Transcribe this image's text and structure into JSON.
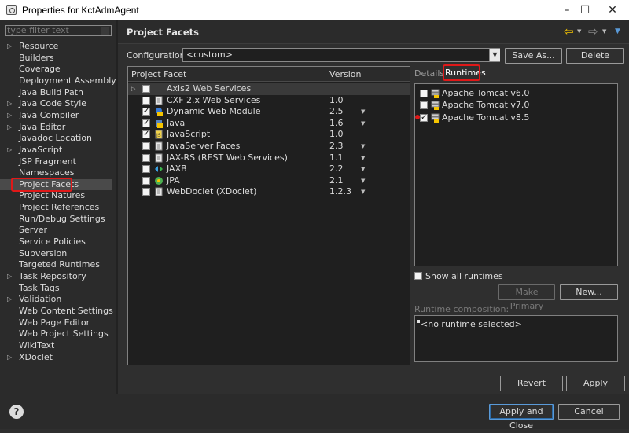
{
  "window": {
    "title": "Properties for KctAdmAgent",
    "minimize": "–",
    "maximize": "☐",
    "close": "✕"
  },
  "sidebar": {
    "filter_placeholder": "type filter text",
    "items": [
      {
        "label": "Resource",
        "expandable": true
      },
      {
        "label": "Builders",
        "expandable": false
      },
      {
        "label": "Coverage",
        "expandable": false
      },
      {
        "label": "Deployment Assembly",
        "expandable": false
      },
      {
        "label": "Java Build Path",
        "expandable": false
      },
      {
        "label": "Java Code Style",
        "expandable": true
      },
      {
        "label": "Java Compiler",
        "expandable": true
      },
      {
        "label": "Java Editor",
        "expandable": true
      },
      {
        "label": "Javadoc Location",
        "expandable": false
      },
      {
        "label": "JavaScript",
        "expandable": true
      },
      {
        "label": "JSP Fragment",
        "expandable": false
      },
      {
        "label": "Namespaces",
        "expandable": false
      },
      {
        "label": "Project Facets",
        "expandable": false,
        "selected": true
      },
      {
        "label": "Project Natures",
        "expandable": false
      },
      {
        "label": "Project References",
        "expandable": false
      },
      {
        "label": "Run/Debug Settings",
        "expandable": false
      },
      {
        "label": "Server",
        "expandable": false
      },
      {
        "label": "Service Policies",
        "expandable": false
      },
      {
        "label": "Subversion",
        "expandable": false
      },
      {
        "label": "Targeted Runtimes",
        "expandable": false
      },
      {
        "label": "Task Repository",
        "expandable": true
      },
      {
        "label": "Task Tags",
        "expandable": false
      },
      {
        "label": "Validation",
        "expandable": true
      },
      {
        "label": "Web Content Settings",
        "expandable": false
      },
      {
        "label": "Web Page Editor",
        "expandable": false
      },
      {
        "label": "Web Project Settings",
        "expandable": false
      },
      {
        "label": "WikiText",
        "expandable": false
      },
      {
        "label": "XDoclet",
        "expandable": true
      }
    ]
  },
  "header": {
    "title": "Project Facets",
    "back_icon": "arrow-left-icon",
    "forward_icon": "arrow-right-icon",
    "menu_icon": "chevron-down-icon",
    "accent_color": "#f5c400"
  },
  "configuration": {
    "label": "Configuration:",
    "value": "<custom>",
    "save_as": "Save As...",
    "delete": "Delete"
  },
  "facets": {
    "col_facet": "Project Facet",
    "col_version": "Version",
    "rows": [
      {
        "name": "Axis2 Web Services",
        "version": "",
        "checked": false,
        "expandable": true,
        "has_dropdown": false,
        "icon": "none",
        "highlight": true
      },
      {
        "name": "CXF 2.x Web Services",
        "version": "1.0",
        "checked": false,
        "expandable": false,
        "has_dropdown": false,
        "icon": "document-icon"
      },
      {
        "name": "Dynamic Web Module",
        "version": "2.5",
        "checked": true,
        "expandable": false,
        "has_dropdown": true,
        "icon": "web-module-icon"
      },
      {
        "name": "Java",
        "version": "1.6",
        "checked": true,
        "expandable": false,
        "has_dropdown": true,
        "icon": "java-icon"
      },
      {
        "name": "JavaScript",
        "version": "1.0",
        "checked": true,
        "expandable": false,
        "has_dropdown": false,
        "icon": "javascript-icon"
      },
      {
        "name": "JavaServer Faces",
        "version": "2.3",
        "checked": false,
        "expandable": false,
        "has_dropdown": true,
        "icon": "document-icon"
      },
      {
        "name": "JAX-RS (REST Web Services)",
        "version": "1.1",
        "checked": false,
        "expandable": false,
        "has_dropdown": true,
        "icon": "document-icon"
      },
      {
        "name": "JAXB",
        "version": "2.2",
        "checked": false,
        "expandable": false,
        "has_dropdown": true,
        "icon": "jaxb-icon"
      },
      {
        "name": "JPA",
        "version": "2.1",
        "checked": false,
        "expandable": false,
        "has_dropdown": true,
        "icon": "jpa-icon"
      },
      {
        "name": "WebDoclet (XDoclet)",
        "version": "1.2.3",
        "checked": false,
        "expandable": false,
        "has_dropdown": true,
        "icon": "document-icon"
      }
    ]
  },
  "details_tab": "Details",
  "runtimes_tab": "Runtimes",
  "runtimes": [
    {
      "name": "Apache Tomcat v6.0",
      "checked": false,
      "warning": false
    },
    {
      "name": "Apache Tomcat v7.0",
      "checked": false,
      "warning": false
    },
    {
      "name": "Apache Tomcat v8.5",
      "checked": true,
      "warning": true
    }
  ],
  "show_all_runtimes": "Show all runtimes",
  "make_primary": "Make Primary",
  "new_button": "New...",
  "runtime_composition_label": "Runtime composition:",
  "runtime_composition_value": "<no runtime selected>",
  "revert": "Revert",
  "apply": "Apply",
  "apply_and_close": "Apply and Close",
  "cancel": "Cancel",
  "help": "?"
}
